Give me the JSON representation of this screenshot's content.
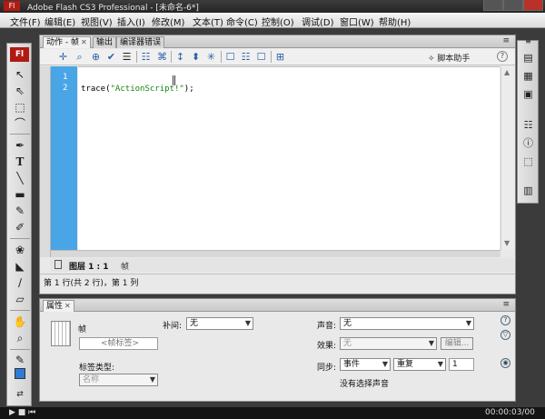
{
  "window": {
    "title": "Adobe Flash CS3 Professional - [未命名-6*]"
  },
  "menu": [
    "文件(F)",
    "编辑(E)",
    "视图(V)",
    "插入(I)",
    "修改(M)",
    "文本(T)",
    "命令(C)",
    "控制(O)",
    "调试(D)",
    "窗口(W)",
    "帮助(H)"
  ],
  "toolbox": {
    "logo": "Fl"
  },
  "actions_panel": {
    "tabs": [
      "动作 - 帧",
      "输出",
      "编译器错误"
    ],
    "script_assist": "脚本助手",
    "line_numbers": [
      "1",
      "2"
    ],
    "code": {
      "fn": "trace(",
      "string": "\"ActionScript!\"",
      "end": ");"
    },
    "nav_layer": "图层 1 : 1",
    "nav_frame": "帧",
    "status": "第 1 行(共 2 行)，第 1 列"
  },
  "properties_panel": {
    "tab": "属性",
    "frame_label": "帧",
    "frame_name_placeholder": "<帧标签>",
    "label_type_label": "标签类型:",
    "label_type_value": "名称",
    "tween_label": "补间:",
    "tween_value": "无",
    "sound_label": "声音:",
    "sound_value": "无",
    "effect_label": "效果:",
    "effect_value": "无",
    "edit_button": "编辑...",
    "sync_label": "同步:",
    "sync_value": "事件",
    "repeat_value": "重复",
    "repeat_count": "1",
    "no_sound": "没有选择声音"
  },
  "player": {
    "time": "00:00:03/00"
  },
  "colors": {
    "gutter": "#49a5e6",
    "string": "#138513",
    "logo": "#b11a12"
  }
}
